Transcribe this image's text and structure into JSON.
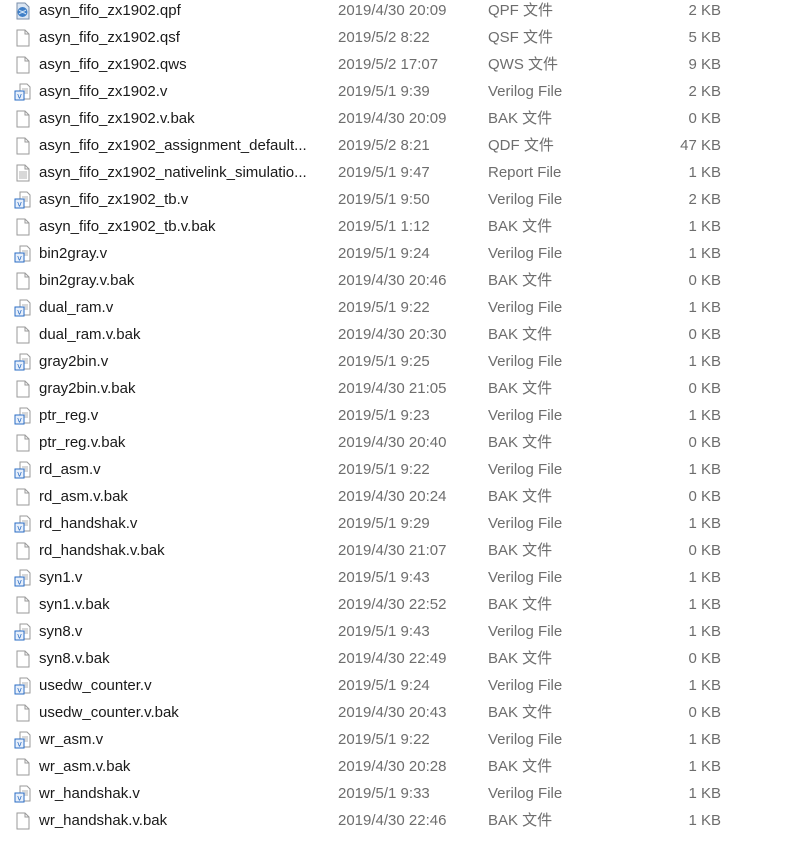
{
  "files": [
    {
      "name": "asyn_fifo_zx1902.qpf",
      "date": "2019/4/30 20:09",
      "type": "QPF 文件",
      "size": "2 KB",
      "icon": "quartus-project-icon"
    },
    {
      "name": "asyn_fifo_zx1902.qsf",
      "date": "2019/5/2 8:22",
      "type": "QSF 文件",
      "size": "5 KB",
      "icon": "blank-file-icon"
    },
    {
      "name": "asyn_fifo_zx1902.qws",
      "date": "2019/5/2 17:07",
      "type": "QWS 文件",
      "size": "9 KB",
      "icon": "blank-file-icon"
    },
    {
      "name": "asyn_fifo_zx1902.v",
      "date": "2019/5/1 9:39",
      "type": "Verilog File",
      "size": "2 KB",
      "icon": "verilog-file-icon"
    },
    {
      "name": "asyn_fifo_zx1902.v.bak",
      "date": "2019/4/30 20:09",
      "type": "BAK 文件",
      "size": "0 KB",
      "icon": "blank-file-icon"
    },
    {
      "name": "asyn_fifo_zx1902_assignment_default...",
      "date": "2019/5/2 8:21",
      "type": "QDF 文件",
      "size": "47 KB",
      "icon": "blank-file-icon"
    },
    {
      "name": "asyn_fifo_zx1902_nativelink_simulatio...",
      "date": "2019/5/1 9:47",
      "type": "Report File",
      "size": "1 KB",
      "icon": "report-file-icon"
    },
    {
      "name": "asyn_fifo_zx1902_tb.v",
      "date": "2019/5/1 9:50",
      "type": "Verilog File",
      "size": "2 KB",
      "icon": "verilog-file-icon"
    },
    {
      "name": "asyn_fifo_zx1902_tb.v.bak",
      "date": "2019/5/1 1:12",
      "type": "BAK 文件",
      "size": "1 KB",
      "icon": "blank-file-icon"
    },
    {
      "name": "bin2gray.v",
      "date": "2019/5/1 9:24",
      "type": "Verilog File",
      "size": "1 KB",
      "icon": "verilog-file-icon"
    },
    {
      "name": "bin2gray.v.bak",
      "date": "2019/4/30 20:46",
      "type": "BAK 文件",
      "size": "0 KB",
      "icon": "blank-file-icon"
    },
    {
      "name": "dual_ram.v",
      "date": "2019/5/1 9:22",
      "type": "Verilog File",
      "size": "1 KB",
      "icon": "verilog-file-icon"
    },
    {
      "name": "dual_ram.v.bak",
      "date": "2019/4/30 20:30",
      "type": "BAK 文件",
      "size": "0 KB",
      "icon": "blank-file-icon"
    },
    {
      "name": "gray2bin.v",
      "date": "2019/5/1 9:25",
      "type": "Verilog File",
      "size": "1 KB",
      "icon": "verilog-file-icon"
    },
    {
      "name": "gray2bin.v.bak",
      "date": "2019/4/30 21:05",
      "type": "BAK 文件",
      "size": "0 KB",
      "icon": "blank-file-icon"
    },
    {
      "name": "ptr_reg.v",
      "date": "2019/5/1 9:23",
      "type": "Verilog File",
      "size": "1 KB",
      "icon": "verilog-file-icon"
    },
    {
      "name": "ptr_reg.v.bak",
      "date": "2019/4/30 20:40",
      "type": "BAK 文件",
      "size": "0 KB",
      "icon": "blank-file-icon"
    },
    {
      "name": "rd_asm.v",
      "date": "2019/5/1 9:22",
      "type": "Verilog File",
      "size": "1 KB",
      "icon": "verilog-file-icon"
    },
    {
      "name": "rd_asm.v.bak",
      "date": "2019/4/30 20:24",
      "type": "BAK 文件",
      "size": "0 KB",
      "icon": "blank-file-icon"
    },
    {
      "name": "rd_handshak.v",
      "date": "2019/5/1 9:29",
      "type": "Verilog File",
      "size": "1 KB",
      "icon": "verilog-file-icon"
    },
    {
      "name": "rd_handshak.v.bak",
      "date": "2019/4/30 21:07",
      "type": "BAK 文件",
      "size": "0 KB",
      "icon": "blank-file-icon"
    },
    {
      "name": "syn1.v",
      "date": "2019/5/1 9:43",
      "type": "Verilog File",
      "size": "1 KB",
      "icon": "verilog-file-icon"
    },
    {
      "name": "syn1.v.bak",
      "date": "2019/4/30 22:52",
      "type": "BAK 文件",
      "size": "1 KB",
      "icon": "blank-file-icon"
    },
    {
      "name": "syn8.v",
      "date": "2019/5/1 9:43",
      "type": "Verilog File",
      "size": "1 KB",
      "icon": "verilog-file-icon"
    },
    {
      "name": "syn8.v.bak",
      "date": "2019/4/30 22:49",
      "type": "BAK 文件",
      "size": "0 KB",
      "icon": "blank-file-icon"
    },
    {
      "name": "usedw_counter.v",
      "date": "2019/5/1 9:24",
      "type": "Verilog File",
      "size": "1 KB",
      "icon": "verilog-file-icon"
    },
    {
      "name": "usedw_counter.v.bak",
      "date": "2019/4/30 20:43",
      "type": "BAK 文件",
      "size": "0 KB",
      "icon": "blank-file-icon"
    },
    {
      "name": "wr_asm.v",
      "date": "2019/5/1 9:22",
      "type": "Verilog File",
      "size": "1 KB",
      "icon": "verilog-file-icon"
    },
    {
      "name": "wr_asm.v.bak",
      "date": "2019/4/30 20:28",
      "type": "BAK 文件",
      "size": "1 KB",
      "icon": "blank-file-icon"
    },
    {
      "name": "wr_handshak.v",
      "date": "2019/5/1 9:33",
      "type": "Verilog File",
      "size": "1 KB",
      "icon": "verilog-file-icon"
    },
    {
      "name": "wr_handshak.v.bak",
      "date": "2019/4/30 22:46",
      "type": "BAK 文件",
      "size": "1 KB",
      "icon": "blank-file-icon"
    }
  ]
}
